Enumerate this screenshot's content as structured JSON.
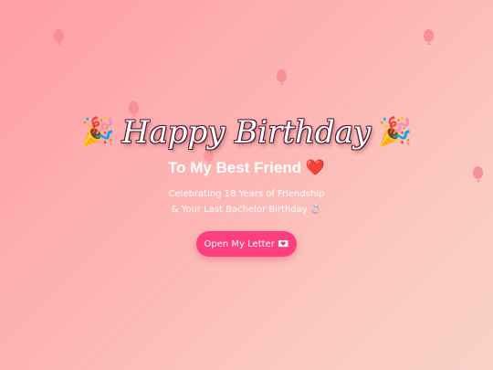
{
  "header": {
    "left_icon": "🎉",
    "title": "Happy Birthday",
    "right_icon": "🎉"
  },
  "subtitle": {
    "text": "To My Best Friend",
    "heart": "❤️"
  },
  "message": {
    "line1": "Celebrating 18 Years of Friendship",
    "line2": "& Your Last Bachelor Birthday 💍"
  },
  "button": {
    "label": "Open My Letter 💌"
  },
  "decor": {
    "balloon_icon": "balloon-icon",
    "balloon_color": "#f78c92"
  },
  "colors": {
    "background_start": "#fe9fa6",
    "background_end": "#f9d2c8",
    "button": "#fd3f7d",
    "text": "#ffffff"
  }
}
